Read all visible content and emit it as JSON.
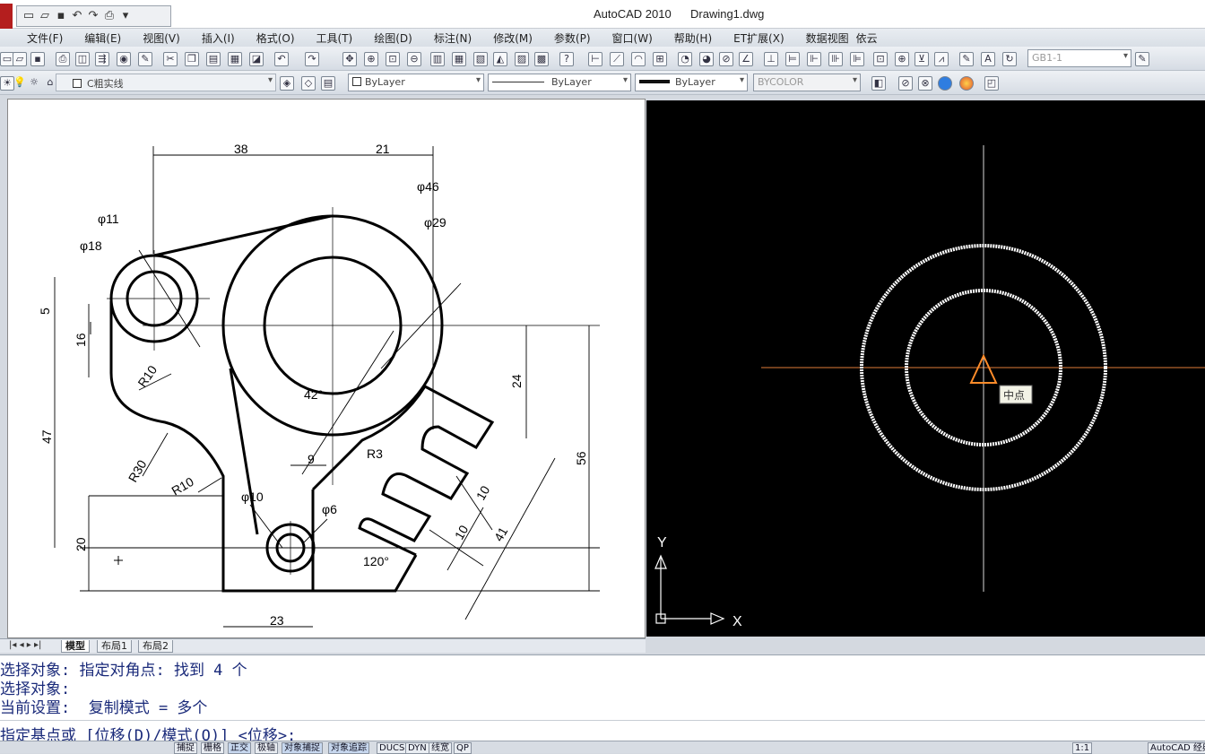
{
  "window": {
    "app_title": "AutoCAD 2010",
    "document_title": "Drawing1.dwg"
  },
  "menu": [
    "文件(F)",
    "编辑(E)",
    "视图(V)",
    "插入(I)",
    "格式(O)",
    "工具(T)",
    "绘图(D)",
    "标注(N)",
    "修改(M)",
    "参数(P)",
    "窗口(W)",
    "帮助(H)",
    "ET扩展(X)",
    "数据视图",
    "依云"
  ],
  "toolbar": {
    "dimstyle_combo": "GB1-1",
    "layer_combo": "C粗实线",
    "color_combo": "ByLayer",
    "linetype_combo": "ByLayer",
    "lineweight_combo": "ByLayer",
    "plotstyle_combo": "BYCOLOR"
  },
  "drawing": {
    "dims": [
      "38",
      "21",
      "φ46",
      "φ29",
      "φ11",
      "φ18",
      "5",
      "16",
      "R10",
      "47",
      "42°",
      "24",
      "56",
      "R3",
      "9",
      "R30",
      "R10",
      "φ10",
      "φ6",
      "10",
      "10",
      "41",
      "20",
      "120°",
      "23"
    ]
  },
  "viewport_right": {
    "snap_tooltip": "中点",
    "ucs_x": "X",
    "ucs_y": "Y"
  },
  "layout_tabs": [
    "模型",
    "布局1",
    "布局2"
  ],
  "command": {
    "history": [
      "选择对象: 指定对角点: 找到 4 个",
      "选择对象:",
      "当前设置:  复制模式 = 多个"
    ],
    "prompt": "指定基点或 [位移(D)/模式(O)] <位移>:"
  },
  "status": {
    "toggles": [
      "捕捉",
      "栅格",
      "正交",
      "极轴",
      "对象捕捉",
      "对象追踪",
      "DUCS",
      "DYN",
      "线宽",
      "QP"
    ],
    "active": [
      "正交",
      "对象捕捉",
      "对象追踪"
    ],
    "scale": "1:1",
    "workspace": "AutoCAD 经典"
  },
  "colors": {
    "accent": "#b41e1e",
    "snap_marker": "#ff8c2a",
    "cmd_text": "#1a2a7a"
  }
}
